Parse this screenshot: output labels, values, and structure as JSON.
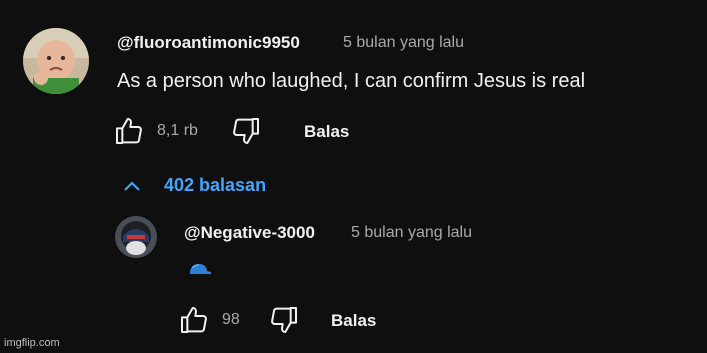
{
  "comment": {
    "handle": "@fluoroantimonic9950",
    "time": "5 bulan yang lalu",
    "text": "As a person who laughed, I can confirm Jesus is real",
    "like_count": "8,1 rb",
    "reply_label": "Balas",
    "replies_toggle": "402 balasan"
  },
  "reply": {
    "handle": "@Negative-3000",
    "time": "5 bulan yang lalu",
    "like_count": "98",
    "reply_label": "Balas"
  },
  "watermark": "imgflip.com",
  "colors": {
    "background": "#0f0f0f",
    "link_blue": "#3ea6ff",
    "muted_text": "#aaaaaa"
  },
  "icons": [
    "thumbs-up-icon",
    "thumbs-down-icon",
    "chevron-up-icon",
    "blue-cap-emoji-icon"
  ]
}
